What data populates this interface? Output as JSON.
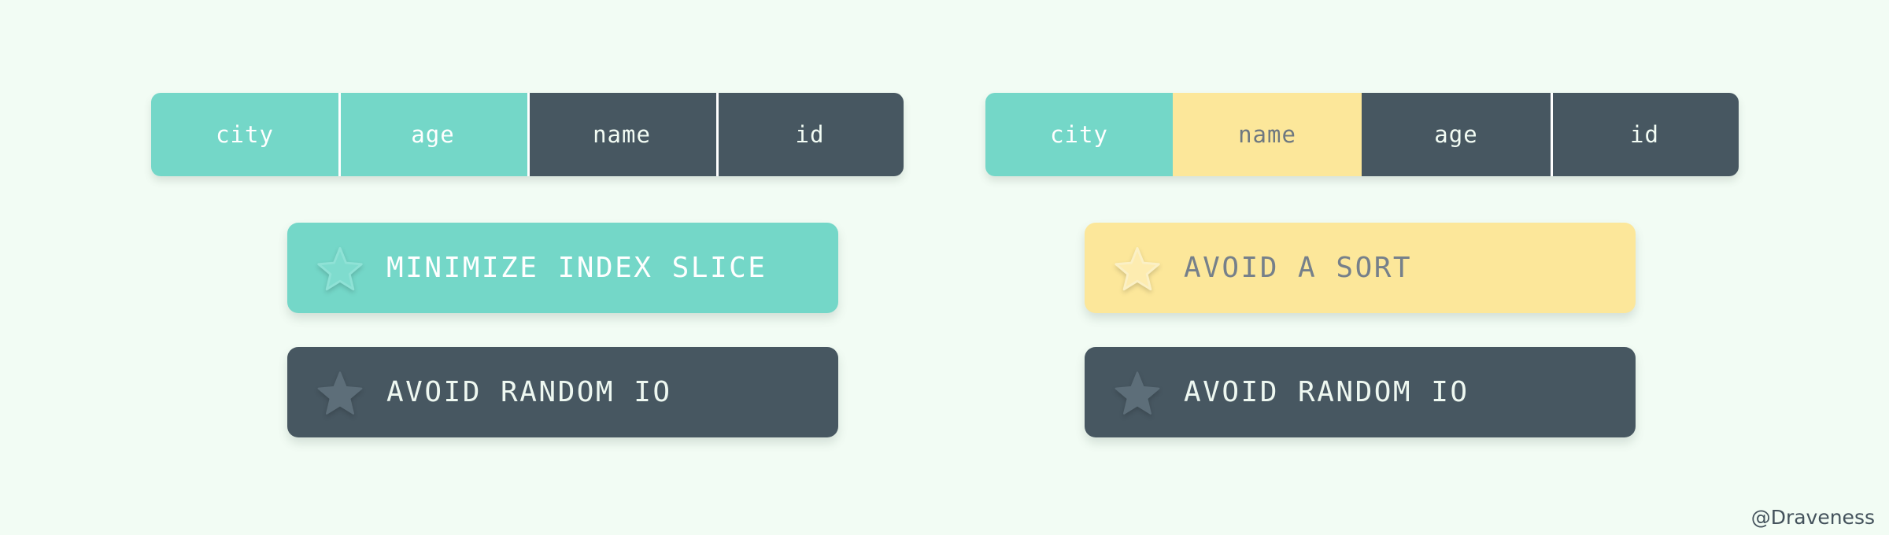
{
  "page": {
    "background_color": "#f2fcf4",
    "watermark": "@Draveness"
  },
  "colors": {
    "teal": "#74d7c8",
    "yellow": "#fce79a",
    "dark": "#475761",
    "white_text": "#ffffff",
    "gray_text": "#76808a",
    "divider": "#ffffff"
  },
  "panels": [
    {
      "id": "left-panel",
      "index_bar": {
        "name": "index-column-bar-left",
        "segments": [
          {
            "label": "city",
            "tone": "teal",
            "divider": false
          },
          {
            "label": "age",
            "tone": "teal",
            "divider": true
          },
          {
            "label": "name",
            "tone": "dark",
            "divider": true
          },
          {
            "label": "id",
            "tone": "dark",
            "divider": true
          }
        ]
      },
      "badges": [
        {
          "label": "MINIMIZE INDEX SLICE",
          "tone": "teal",
          "icon": "star-outline-icon"
        },
        {
          "label": "AVOID RANDOM IO",
          "tone": "dark",
          "icon": "star-filled-icon"
        }
      ]
    },
    {
      "id": "right-panel",
      "index_bar": {
        "name": "index-column-bar-right",
        "segments": [
          {
            "label": "city",
            "tone": "teal",
            "divider": false
          },
          {
            "label": "name",
            "tone": "yellow",
            "divider": false
          },
          {
            "label": "age",
            "tone": "dark",
            "divider": false
          },
          {
            "label": "id",
            "tone": "dark",
            "divider": true
          }
        ]
      },
      "badges": [
        {
          "label": "AVOID A SORT",
          "tone": "yellow",
          "icon": "star-outline-icon"
        },
        {
          "label": "AVOID RANDOM IO",
          "tone": "dark",
          "icon": "star-filled-icon"
        }
      ]
    }
  ]
}
